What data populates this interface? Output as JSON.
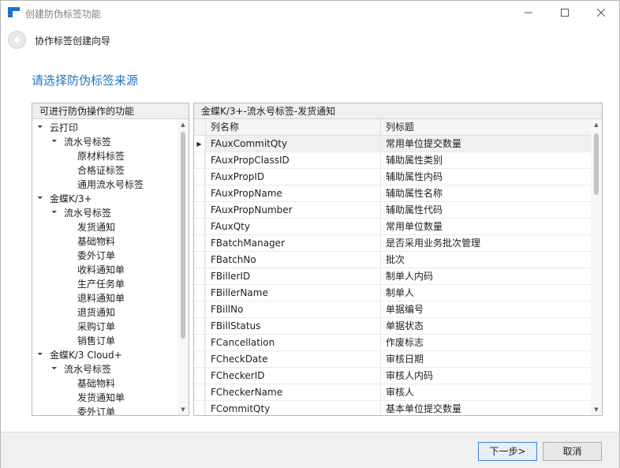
{
  "window": {
    "title": "创建防伪标签功能",
    "accent_color": "#1f73c2"
  },
  "wizard": {
    "header_title": "协作标签创建向导",
    "subtitle": "请选择防伪标签来源"
  },
  "left_panel": {
    "title": "可进行防伪操作的功能",
    "tree": [
      {
        "label": "云打印",
        "level": 0,
        "expanded": true
      },
      {
        "label": "流水号标签",
        "level": 1,
        "expanded": true
      },
      {
        "label": "原材料标签",
        "level": 2
      },
      {
        "label": "合格证标签",
        "level": 2
      },
      {
        "label": "通用流水号标签",
        "level": 2
      },
      {
        "label": "金蝶K/3+",
        "level": 0,
        "expanded": true
      },
      {
        "label": "流水号标签",
        "level": 1,
        "expanded": true
      },
      {
        "label": "发货通知",
        "level": 2
      },
      {
        "label": "基础物料",
        "level": 2
      },
      {
        "label": "委外订单",
        "level": 2
      },
      {
        "label": "收料通知单",
        "level": 2
      },
      {
        "label": "生产任务单",
        "level": 2
      },
      {
        "label": "退料通知单",
        "level": 2
      },
      {
        "label": "退货通知",
        "level": 2
      },
      {
        "label": "采购订单",
        "level": 2
      },
      {
        "label": "销售订单",
        "level": 2
      },
      {
        "label": "金蝶K/3 Cloud+",
        "level": 0,
        "expanded": true
      },
      {
        "label": "流水号标签",
        "level": 1,
        "expanded": true
      },
      {
        "label": "基础物料",
        "level": 2
      },
      {
        "label": "发货通知单",
        "level": 2
      },
      {
        "label": "委外订单",
        "level": 2
      }
    ]
  },
  "right_panel": {
    "title": "金蝶K/3+-流水号标签-发货通知",
    "columns": [
      "列名称",
      "列标题"
    ],
    "rows": [
      {
        "name": "FAuxCommitQty",
        "title": "常用单位提交数量",
        "selected": true
      },
      {
        "name": "FAuxPropClassID",
        "title": "辅助属性类别"
      },
      {
        "name": "FAuxPropID",
        "title": "辅助属性内码"
      },
      {
        "name": "FAuxPropName",
        "title": "辅助属性名称"
      },
      {
        "name": "FAuxPropNumber",
        "title": "辅助属性代码"
      },
      {
        "name": "FAuxQty",
        "title": "常用单位数量"
      },
      {
        "name": "FBatchManager",
        "title": "是否采用业务批次管理"
      },
      {
        "name": "FBatchNo",
        "title": "批次"
      },
      {
        "name": "FBillerID",
        "title": "制单人内码"
      },
      {
        "name": "FBillerName",
        "title": "制单人"
      },
      {
        "name": "FBillNo",
        "title": "单据编号"
      },
      {
        "name": "FBillStatus",
        "title": "单据状态"
      },
      {
        "name": "FCancellation",
        "title": "作废标志"
      },
      {
        "name": "FCheckDate",
        "title": "审核日期"
      },
      {
        "name": "FCheckerID",
        "title": "审核人内码"
      },
      {
        "name": "FCheckerName",
        "title": "审核人"
      },
      {
        "name": "FCommitQty",
        "title": "基本单位提交数量"
      }
    ]
  },
  "footer": {
    "next_label": "下一步>",
    "cancel_label": "取消"
  }
}
